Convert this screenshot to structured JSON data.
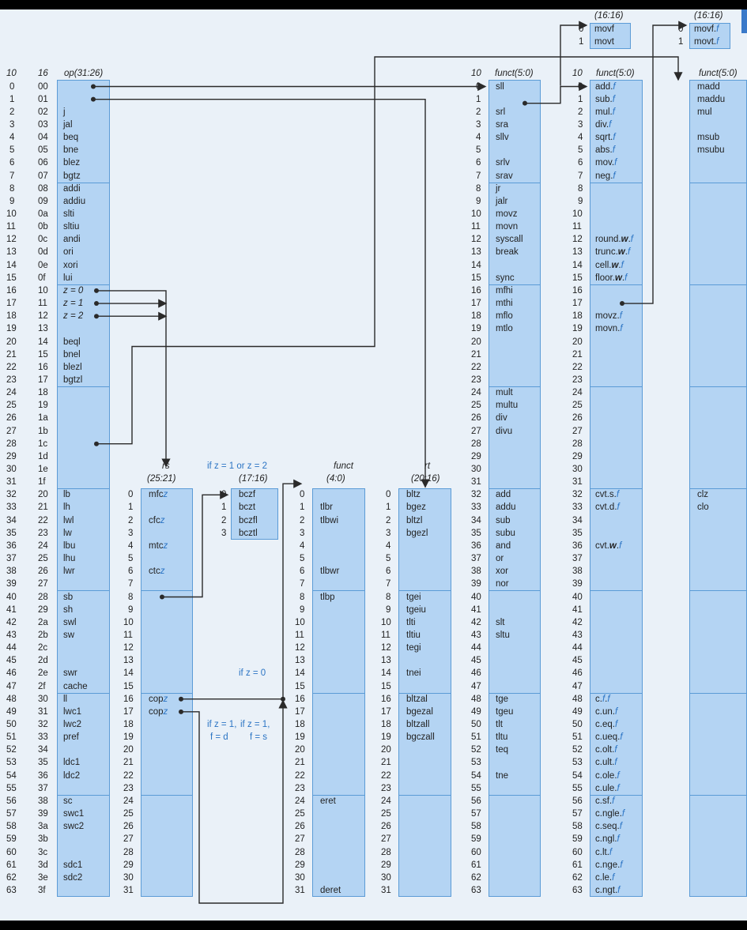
{
  "opcode": {
    "h10": "10",
    "h16": "16",
    "hname": "op(31:26)",
    "dec": [
      "0",
      "1",
      "2",
      "3",
      "4",
      "5",
      "6",
      "7",
      "8",
      "9",
      "10",
      "11",
      "12",
      "13",
      "14",
      "15",
      "16",
      "17",
      "18",
      "19",
      "20",
      "21",
      "22",
      "23",
      "24",
      "25",
      "26",
      "27",
      "28",
      "29",
      "30",
      "31",
      "32",
      "33",
      "34",
      "35",
      "36",
      "37",
      "38",
      "39",
      "40",
      "41",
      "42",
      "43",
      "44",
      "45",
      "46",
      "47",
      "48",
      "49",
      "50",
      "51",
      "52",
      "53",
      "54",
      "55",
      "56",
      "57",
      "58",
      "59",
      "60",
      "61",
      "62",
      "63"
    ],
    "hex": [
      "00",
      "01",
      "02",
      "03",
      "04",
      "05",
      "06",
      "07",
      "08",
      "09",
      "0a",
      "0b",
      "0c",
      "0d",
      "0e",
      "0f",
      "10",
      "11",
      "12",
      "13",
      "14",
      "15",
      "16",
      "17",
      "18",
      "19",
      "1a",
      "1b",
      "1c",
      "1d",
      "1e",
      "1f",
      "20",
      "21",
      "22",
      "23",
      "24",
      "25",
      "26",
      "27",
      "28",
      "29",
      "2a",
      "2b",
      "2c",
      "2d",
      "2e",
      "2f",
      "30",
      "31",
      "32",
      "33",
      "34",
      "35",
      "36",
      "37",
      "38",
      "39",
      "3a",
      "3b",
      "3c",
      "3d",
      "3e",
      "3f"
    ],
    "names": [
      "",
      "",
      "j",
      "jal",
      "beq",
      "bne",
      "blez",
      "bgtz",
      "addi",
      "addiu",
      "slti",
      "sltiu",
      "andi",
      "ori",
      "xori",
      "lui",
      "z = 0",
      "z = 1",
      "z = 2",
      "",
      "beql",
      "bnel",
      "blezl",
      "bgtzl",
      "",
      "",
      "",
      "",
      "",
      "",
      "",
      "",
      "lb",
      "lh",
      "lwl",
      "lw",
      "lbu",
      "lhu",
      "lwr",
      "",
      "sb",
      "sh",
      "swl",
      "sw",
      "",
      "",
      "swr",
      "cache",
      "ll",
      "lwc1",
      "lwc2",
      "pref",
      "",
      "ldc1",
      "ldc2",
      "",
      "sc",
      "swc1",
      "swc2",
      "",
      "",
      "sdc1",
      "sdc2",
      ""
    ]
  },
  "rs": {
    "h1": "rs",
    "h2": "(25:21)",
    "nums": [
      "0",
      "1",
      "2",
      "3",
      "4",
      "5",
      "6",
      "7",
      "8",
      "9",
      "10",
      "11",
      "12",
      "13",
      "14",
      "15",
      "16",
      "17",
      "18",
      "19",
      "20",
      "21",
      "22",
      "23",
      "24",
      "25",
      "26",
      "27",
      "28",
      "29",
      "30",
      "31"
    ],
    "names": [
      "mfcz",
      "",
      "cfcz",
      "",
      "mtcz",
      "",
      "ctcz",
      "",
      "",
      "",
      "",
      "",
      "",
      "",
      "",
      "",
      "copz",
      "copz",
      "",
      "",
      "",
      "",
      "",
      "",
      "",
      "",
      "",
      "",
      "",
      "",
      "",
      ""
    ]
  },
  "bc": {
    "cond": "if z = 1 or z = 2",
    "h": "(17:16)",
    "nums": [
      "0",
      "1",
      "2",
      "3"
    ],
    "names": [
      "bczf",
      "bczt",
      "bczfl",
      "bcztl"
    ]
  },
  "notes": {
    "z0": "if z = 0",
    "z1a": "if z = 1,",
    "z1b": "f = d",
    "z1c": "if z = 1,",
    "z1d": "f = s"
  },
  "functcop": {
    "h1": "funct",
    "h2": "(4:0)",
    "nums": [
      "0",
      "1",
      "2",
      "3",
      "4",
      "5",
      "6",
      "7",
      "8",
      "9",
      "10",
      "11",
      "12",
      "13",
      "14",
      "15",
      "16",
      "17",
      "18",
      "19",
      "20",
      "21",
      "22",
      "23",
      "24",
      "25",
      "26",
      "27",
      "28",
      "29",
      "30",
      "31"
    ],
    "names": [
      "",
      "tlbr",
      "tlbwi",
      "",
      "",
      "",
      "tlbwr",
      "",
      "tlbp",
      "",
      "",
      "",
      "",
      "",
      "",
      "",
      "",
      "",
      "",
      "",
      "",
      "",
      "",
      "",
      "eret",
      "",
      "",
      "",
      "",
      "",
      "",
      "deret"
    ]
  },
  "rt": {
    "h1": "rt",
    "h2": "(20:16)",
    "nums": [
      "0",
      "1",
      "2",
      "3",
      "4",
      "5",
      "6",
      "7",
      "8",
      "9",
      "10",
      "11",
      "12",
      "13",
      "14",
      "15",
      "16",
      "17",
      "18",
      "19",
      "20",
      "21",
      "22",
      "23",
      "24",
      "25",
      "26",
      "27",
      "28",
      "29",
      "30",
      "31"
    ],
    "names": [
      "bltz",
      "bgez",
      "bltzl",
      "bgezl",
      "",
      "",
      "",
      "",
      "tgei",
      "tgeiu",
      "tlti",
      "tltiu",
      "tegi",
      "",
      "tnei",
      "",
      "bltzal",
      "bgezal",
      "bltzall",
      "bgczall",
      "",
      "",
      "",
      "",
      "",
      "",
      "",
      "",
      "",
      "",
      "",
      ""
    ]
  },
  "funct": {
    "h10": "10",
    "hname": "funct(5:0)",
    "nums": [
      "0",
      "1",
      "2",
      "3",
      "4",
      "5",
      "6",
      "7",
      "8",
      "9",
      "10",
      "11",
      "12",
      "13",
      "14",
      "15",
      "16",
      "17",
      "18",
      "19",
      "20",
      "21",
      "22",
      "23",
      "24",
      "25",
      "26",
      "27",
      "28",
      "29",
      "30",
      "31",
      "32",
      "33",
      "34",
      "35",
      "36",
      "37",
      "38",
      "39",
      "40",
      "41",
      "42",
      "43",
      "44",
      "45",
      "46",
      "47",
      "48",
      "49",
      "50",
      "51",
      "52",
      "53",
      "54",
      "55",
      "56",
      "57",
      "58",
      "59",
      "60",
      "61",
      "62",
      "63"
    ],
    "names": [
      "sll",
      "",
      "srl",
      "sra",
      "sllv",
      "",
      "srlv",
      "srav",
      "jr",
      "jalr",
      "movz",
      "movn",
      "syscall",
      "break",
      "",
      "sync",
      "mfhi",
      "mthi",
      "mflo",
      "mtlo",
      "",
      "",
      "",
      "",
      "mult",
      "multu",
      "div",
      "divu",
      "",
      "",
      "",
      "",
      "add",
      "addu",
      "sub",
      "subu",
      "and",
      "or",
      "xor",
      "nor",
      "",
      "",
      "slt",
      "sltu",
      "",
      "",
      "",
      "",
      "tge",
      "tgeu",
      "tlt",
      "tltu",
      "teq",
      "",
      "tne",
      "",
      "",
      "",
      "",
      "",
      "",
      "",
      "",
      ""
    ]
  },
  "fp": {
    "h10": "10",
    "hname": "funct(5:0)",
    "nums": [
      "0",
      "1",
      "2",
      "3",
      "4",
      "5",
      "6",
      "7",
      "8",
      "9",
      "10",
      "11",
      "12",
      "13",
      "14",
      "15",
      "16",
      "17",
      "18",
      "19",
      "20",
      "21",
      "22",
      "23",
      "24",
      "25",
      "26",
      "27",
      "28",
      "29",
      "30",
      "31",
      "32",
      "33",
      "34",
      "35",
      "36",
      "37",
      "38",
      "39",
      "40",
      "41",
      "42",
      "43",
      "44",
      "45",
      "46",
      "47",
      "48",
      "49",
      "50",
      "51",
      "52",
      "53",
      "54",
      "55",
      "56",
      "57",
      "58",
      "59",
      "60",
      "61",
      "62",
      "63"
    ],
    "names": [
      "add.f",
      "sub.f",
      "mul.f",
      "div.f",
      "sqrt.f",
      "abs.f",
      "mov.f",
      "neg.f",
      "",
      "",
      "",
      "",
      "round.w.f",
      "trunc.w.f",
      "cell.w.f",
      "floor.w.f",
      "",
      "",
      "movz.f",
      "movn.f",
      "",
      "",
      "",
      "",
      "",
      "",
      "",
      "",
      "",
      "",
      "",
      "",
      "cvt.s.f",
      "cvt.d.f",
      "",
      "",
      "cvt.w.f",
      "",
      "",
      "",
      "",
      "",
      "",
      "",
      "",
      "",
      "",
      "",
      "c.f.f",
      "c.un.f",
      "c.eq.f",
      "c.ueq.f",
      "c.olt.f",
      "c.ult.f",
      "c.ole.f",
      "c.ule.f",
      "c.sf.f",
      "c.ngle.f",
      "c.seq.f",
      "c.ngl.f",
      "c.lt.f",
      "c.nge.f",
      "c.le.f",
      "c.ngt.f"
    ]
  },
  "special2": {
    "hname": "funct(5:0)",
    "names": [
      "madd",
      "maddu",
      "mul",
      "",
      "msub",
      "msubu",
      "",
      "",
      "",
      "",
      "",
      "",
      "",
      "",
      "",
      "",
      "",
      "",
      "",
      "",
      "",
      "",
      "",
      "",
      "",
      "",
      "",
      "",
      "",
      "",
      "",
      "",
      "clz",
      "clo",
      "",
      "",
      "",
      "",
      "",
      "",
      "",
      "",
      "",
      "",
      "",
      "",
      "",
      "",
      "",
      "",
      "",
      "",
      "",
      "",
      "",
      "",
      "",
      "",
      "",
      "",
      "",
      "",
      "",
      ""
    ]
  },
  "movf1": {
    "h": "(16:16)",
    "nums": [
      "0",
      "1"
    ],
    "names": [
      "movf",
      "movt"
    ]
  },
  "movf2": {
    "h": "(16:16)",
    "nums": [
      "0",
      "1"
    ],
    "names": [
      "movf.f",
      "movt.f"
    ]
  }
}
